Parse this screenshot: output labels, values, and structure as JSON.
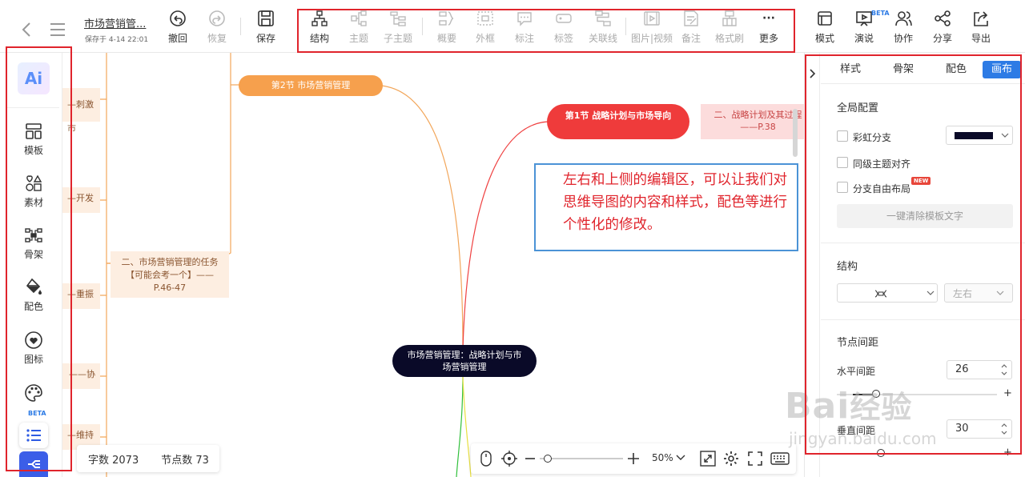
{
  "header": {
    "doc_title": "市场营销管...",
    "saved_time": "保存于 4-14 22:01",
    "undo_label": "撤回",
    "redo_label": "恢复",
    "save_label": "保存"
  },
  "toolbar": {
    "items": [
      {
        "label": "结构"
      },
      {
        "label": "主题"
      },
      {
        "label": "子主题"
      },
      {
        "label": "概要"
      },
      {
        "label": "外框"
      },
      {
        "label": "标注"
      },
      {
        "label": "标签"
      },
      {
        "label": "关联线"
      },
      {
        "label": "图片|视频"
      },
      {
        "label": "备注"
      },
      {
        "label": "格式刷"
      },
      {
        "label": "更多"
      }
    ],
    "more_glyph": "···"
  },
  "right_toolbar": {
    "items": [
      {
        "label": "模式"
      },
      {
        "label": "演说"
      },
      {
        "label": "协作"
      },
      {
        "label": "分享"
      },
      {
        "label": "导出"
      }
    ],
    "beta": "BETA"
  },
  "sidebar": {
    "ai_label": "Ai",
    "items": [
      {
        "label": "模板"
      },
      {
        "label": "素材"
      },
      {
        "label": "骨架"
      },
      {
        "label": "配色"
      },
      {
        "label": "图标"
      }
    ],
    "beta": "BETA"
  },
  "canvas": {
    "root": "市场营销管理：战略计划与市场营销管理",
    "section2": "第2节 市场营销管理",
    "section1": "第1节 战略计划与市场导向",
    "section1_child": "二、战略计划及其过程——P.38",
    "left_task": "二、市场营销管理的任务【可能会考一个】——P.46-47",
    "left_labels": [
      "—刺激市",
      "—开发",
      "—重振",
      "——协",
      "—维持"
    ],
    "callout": "左右和上侧的编辑区，可以让我们对思维导图的内容和样式，配色等进行个性化的修改。",
    "stats": {
      "word_label": "字数 2073",
      "node_label": "节点数 73"
    },
    "zoom": "50%"
  },
  "right_panel": {
    "tabs": [
      "样式",
      "骨架",
      "配色",
      "画布"
    ],
    "global_title": "全局配置",
    "rainbow": "彩虹分支",
    "align": "同级主题对齐",
    "free": "分支自由布局",
    "new_badge": "NEW",
    "clear_button": "一键清除模板文字",
    "structure_title": "结构",
    "direction": "左右",
    "spacing_title": "节点间距",
    "h_spacing_label": "水平间距",
    "h_spacing": "26",
    "v_spacing_label": "垂直间距",
    "v_spacing": "30",
    "branch_color": "#0a0a28"
  },
  "watermark": {
    "brand": "Bai",
    "brand2": "经验",
    "url": "jingyan.baidu.com"
  }
}
